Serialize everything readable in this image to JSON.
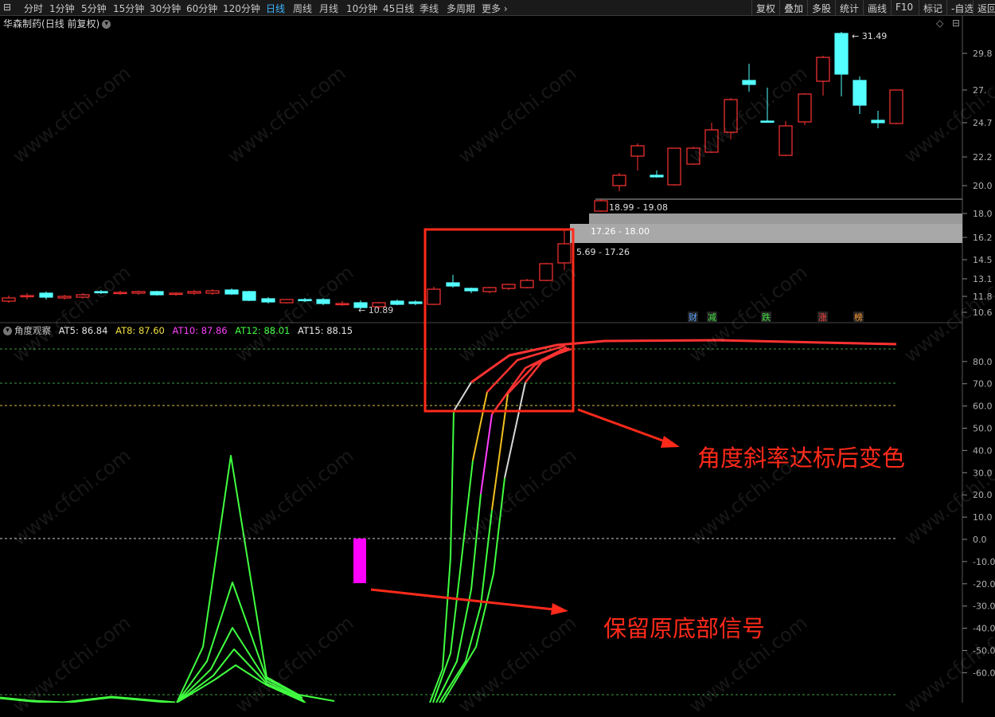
{
  "toolbar": {
    "left_items": [
      "分时",
      "1分钟",
      "5分钟",
      "15分钟",
      "30分钟",
      "60分钟",
      "120分钟",
      "日线",
      "周线",
      "月线",
      "10分钟",
      "45日线",
      "季线",
      "多周期",
      "更多"
    ],
    "active_index": 7,
    "right_items": [
      "复权",
      "叠加",
      "多股",
      "统计",
      "画线",
      "F10",
      "标记",
      "-自选",
      "返回"
    ]
  },
  "stock": {
    "name": "华森制药",
    "period_info": "(日线 前复权)"
  },
  "price_axis": [
    "29.8",
    "27.",
    "24.7",
    "22.2",
    "20.0",
    "18.0",
    "16.2",
    "14.5",
    "13.1",
    "11.8",
    "10.6"
  ],
  "indicator_axis": [
    "80.0",
    "70.0",
    "60.0",
    "50.0",
    "40.0",
    "30.0",
    "20.0",
    "10.0",
    "0.0",
    "-10.0",
    "-20.0",
    "-30.0",
    "-40.0",
    "-50.0",
    "-60.0"
  ],
  "price_labels": {
    "high": "31.49",
    "low": "10.89"
  },
  "volume_bands": [
    "18.99 - 19.08",
    "17.26 - 18.00",
    "5.69 - 17.26"
  ],
  "event_tags": [
    {
      "text": "财",
      "color": "#5aa0ff"
    },
    {
      "text": "减",
      "color": "#40e040"
    },
    {
      "text": "跌",
      "color": "#40e040"
    },
    {
      "text": "涨",
      "color": "#ff4040"
    },
    {
      "text": "榜",
      "color": "#ff9a30"
    }
  ],
  "indicator": {
    "name": "角度观察",
    "items": [
      {
        "label": "AT5: 86.84",
        "color": "#e6e6e6"
      },
      {
        "label": "AT8: 87.60",
        "color": "#f0e040"
      },
      {
        "label": "AT10: 87.86",
        "color": "#ff40ff"
      },
      {
        "label": "AT12: 88.01",
        "color": "#40ff40"
      },
      {
        "label": "AT15: 88.15",
        "color": "#e6e6e6"
      }
    ]
  },
  "annotations": {
    "angle_change": "角度斜率达标后变色",
    "bottom_signal": "保留原底部信号"
  },
  "watermark": "www.cfchi.com",
  "colors": {
    "up": "#ff3232",
    "down": "#54ffff",
    "ma_green": "#40ff40",
    "signal": "#ff00ff"
  }
}
